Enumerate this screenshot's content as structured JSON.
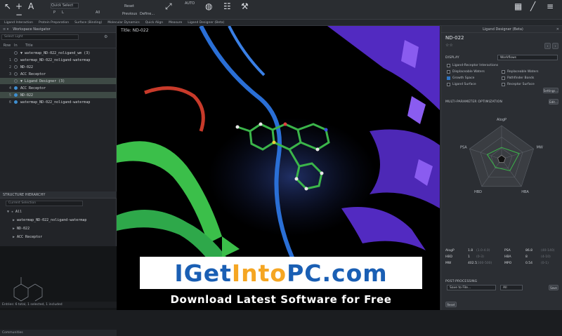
{
  "toolbar": {
    "search_placeholder": "Quick Select",
    "all_label": "All",
    "reset_label": "Reset",
    "previous_label": "Previous",
    "define_label": "Define...",
    "auto_label": "AUTO",
    "residue_labels": [
      "P",
      "L"
    ]
  },
  "task_tabs": [
    "Ligand Interaction",
    "Protein Preparation",
    "Surface (Binding)",
    "Molecular Dynamics",
    "Quick Align",
    "Measure",
    "Ligand Designer (Beta)"
  ],
  "project_table": {
    "title": "Workspace Navigator",
    "filter_placeholder": "Select Light",
    "columns": [
      "Row",
      "In",
      "Title"
    ],
    "rows": [
      {
        "num": "",
        "title": "▼ watermap_ND-022_noligand_wm (3)",
        "included": false,
        "selected": false
      },
      {
        "num": "1",
        "title": "watermap_ND-022_noligand-watermap",
        "included": false,
        "selected": false
      },
      {
        "num": "2",
        "title": "ND-022",
        "included": false,
        "selected": false
      },
      {
        "num": "3",
        "title": "ACC Receptor",
        "included": false,
        "selected": false
      },
      {
        "num": "",
        "title": "▼ Ligand Designer (3)",
        "included": false,
        "selected": true
      },
      {
        "num": "4",
        "title": "ACC Receptor",
        "included": true,
        "selected": false
      },
      {
        "num": "5",
        "title": "ND-022",
        "included": true,
        "selected": true
      },
      {
        "num": "6",
        "title": "watermap_ND-022_noligand-watermap",
        "included": true,
        "selected": false
      }
    ]
  },
  "structure_hierarchy": {
    "title": "STRUCTURE HIERARCHY",
    "filter_placeholder": "Current Selection",
    "items": [
      "All",
      "watermap_ND-022_noligand-watermap",
      "ND-022",
      "ACC Receptor"
    ]
  },
  "status_bar": {
    "text": "Entries: 6 total, 1 selected, 1 included",
    "communities": "Communities"
  },
  "viewport": {
    "title": "Title: ND-022"
  },
  "designer": {
    "panel_title": "Ligand Designer (Beta)",
    "ligand_name": "ND-022",
    "display_label": "DISPLAY",
    "display_mode": "Workflows",
    "options": [
      {
        "label": "Ligand-Receptor Interactions",
        "checked": false
      },
      {
        "label": "Displaceable Waters",
        "checked": false
      },
      {
        "label": "Replaceable Waters",
        "checked": false
      },
      {
        "label": "Growth Space",
        "checked": true
      },
      {
        "label": "Pathfinder Bonds",
        "checked": false
      },
      {
        "label": "Ligand Surface",
        "checked": false
      },
      {
        "label": "Receptor Surface",
        "checked": false
      }
    ],
    "settings_label": "Settings...",
    "mpo_label": "MULTI-PARAMETER OPTIMIZATION",
    "mpo_edit": "Edit...",
    "radar_axes": [
      "AlogP",
      "MW",
      "HBA",
      "HBD",
      "PSA"
    ],
    "radar_values": [
      0.35,
      0.55,
      0.42,
      0.3,
      0.45
    ],
    "properties": [
      {
        "name": "AlogP",
        "value": "1.8",
        "range": "(1.0-4.0)",
        "name2": "PSA",
        "value2": "86.8",
        "range2": "(40-140)"
      },
      {
        "name": "HBD",
        "value": "1",
        "range": "(0-3)",
        "name2": "HBA",
        "value2": "8",
        "range2": "(4-10)"
      },
      {
        "name": "MW",
        "value": "402.5",
        "range": "(300-500)",
        "name2": "MPO",
        "value2": "0.54",
        "range2": "(0-1)"
      }
    ],
    "post_processing_label": "POST-PROCESSING",
    "save_option": "Save to File...",
    "scope_option": "All",
    "save_button": "Save",
    "reset_button": "Reset"
  },
  "banner": {
    "logo_letters": [
      "I",
      "G",
      "e",
      "t",
      "I",
      "n",
      "t",
      "o",
      "P",
      "C",
      ".",
      "c",
      "o",
      "m"
    ],
    "logo_colors": [
      "#1a5fb4",
      "#1a5fb4",
      "#1a5fb4",
      "#1a5fb4",
      "#f5a623",
      "#f5a623",
      "#f5a623",
      "#f5a623",
      "#1a5fb4",
      "#1a5fb4",
      "#1a5fb4",
      "#1a5fb4",
      "#1a5fb4",
      "#1a5fb4"
    ],
    "tagline": "Download Latest Software for Free"
  },
  "colors": {
    "accent": "#2f76c4",
    "growth_space": "#3bb54a",
    "protein_purple": "#5b2fd6"
  }
}
